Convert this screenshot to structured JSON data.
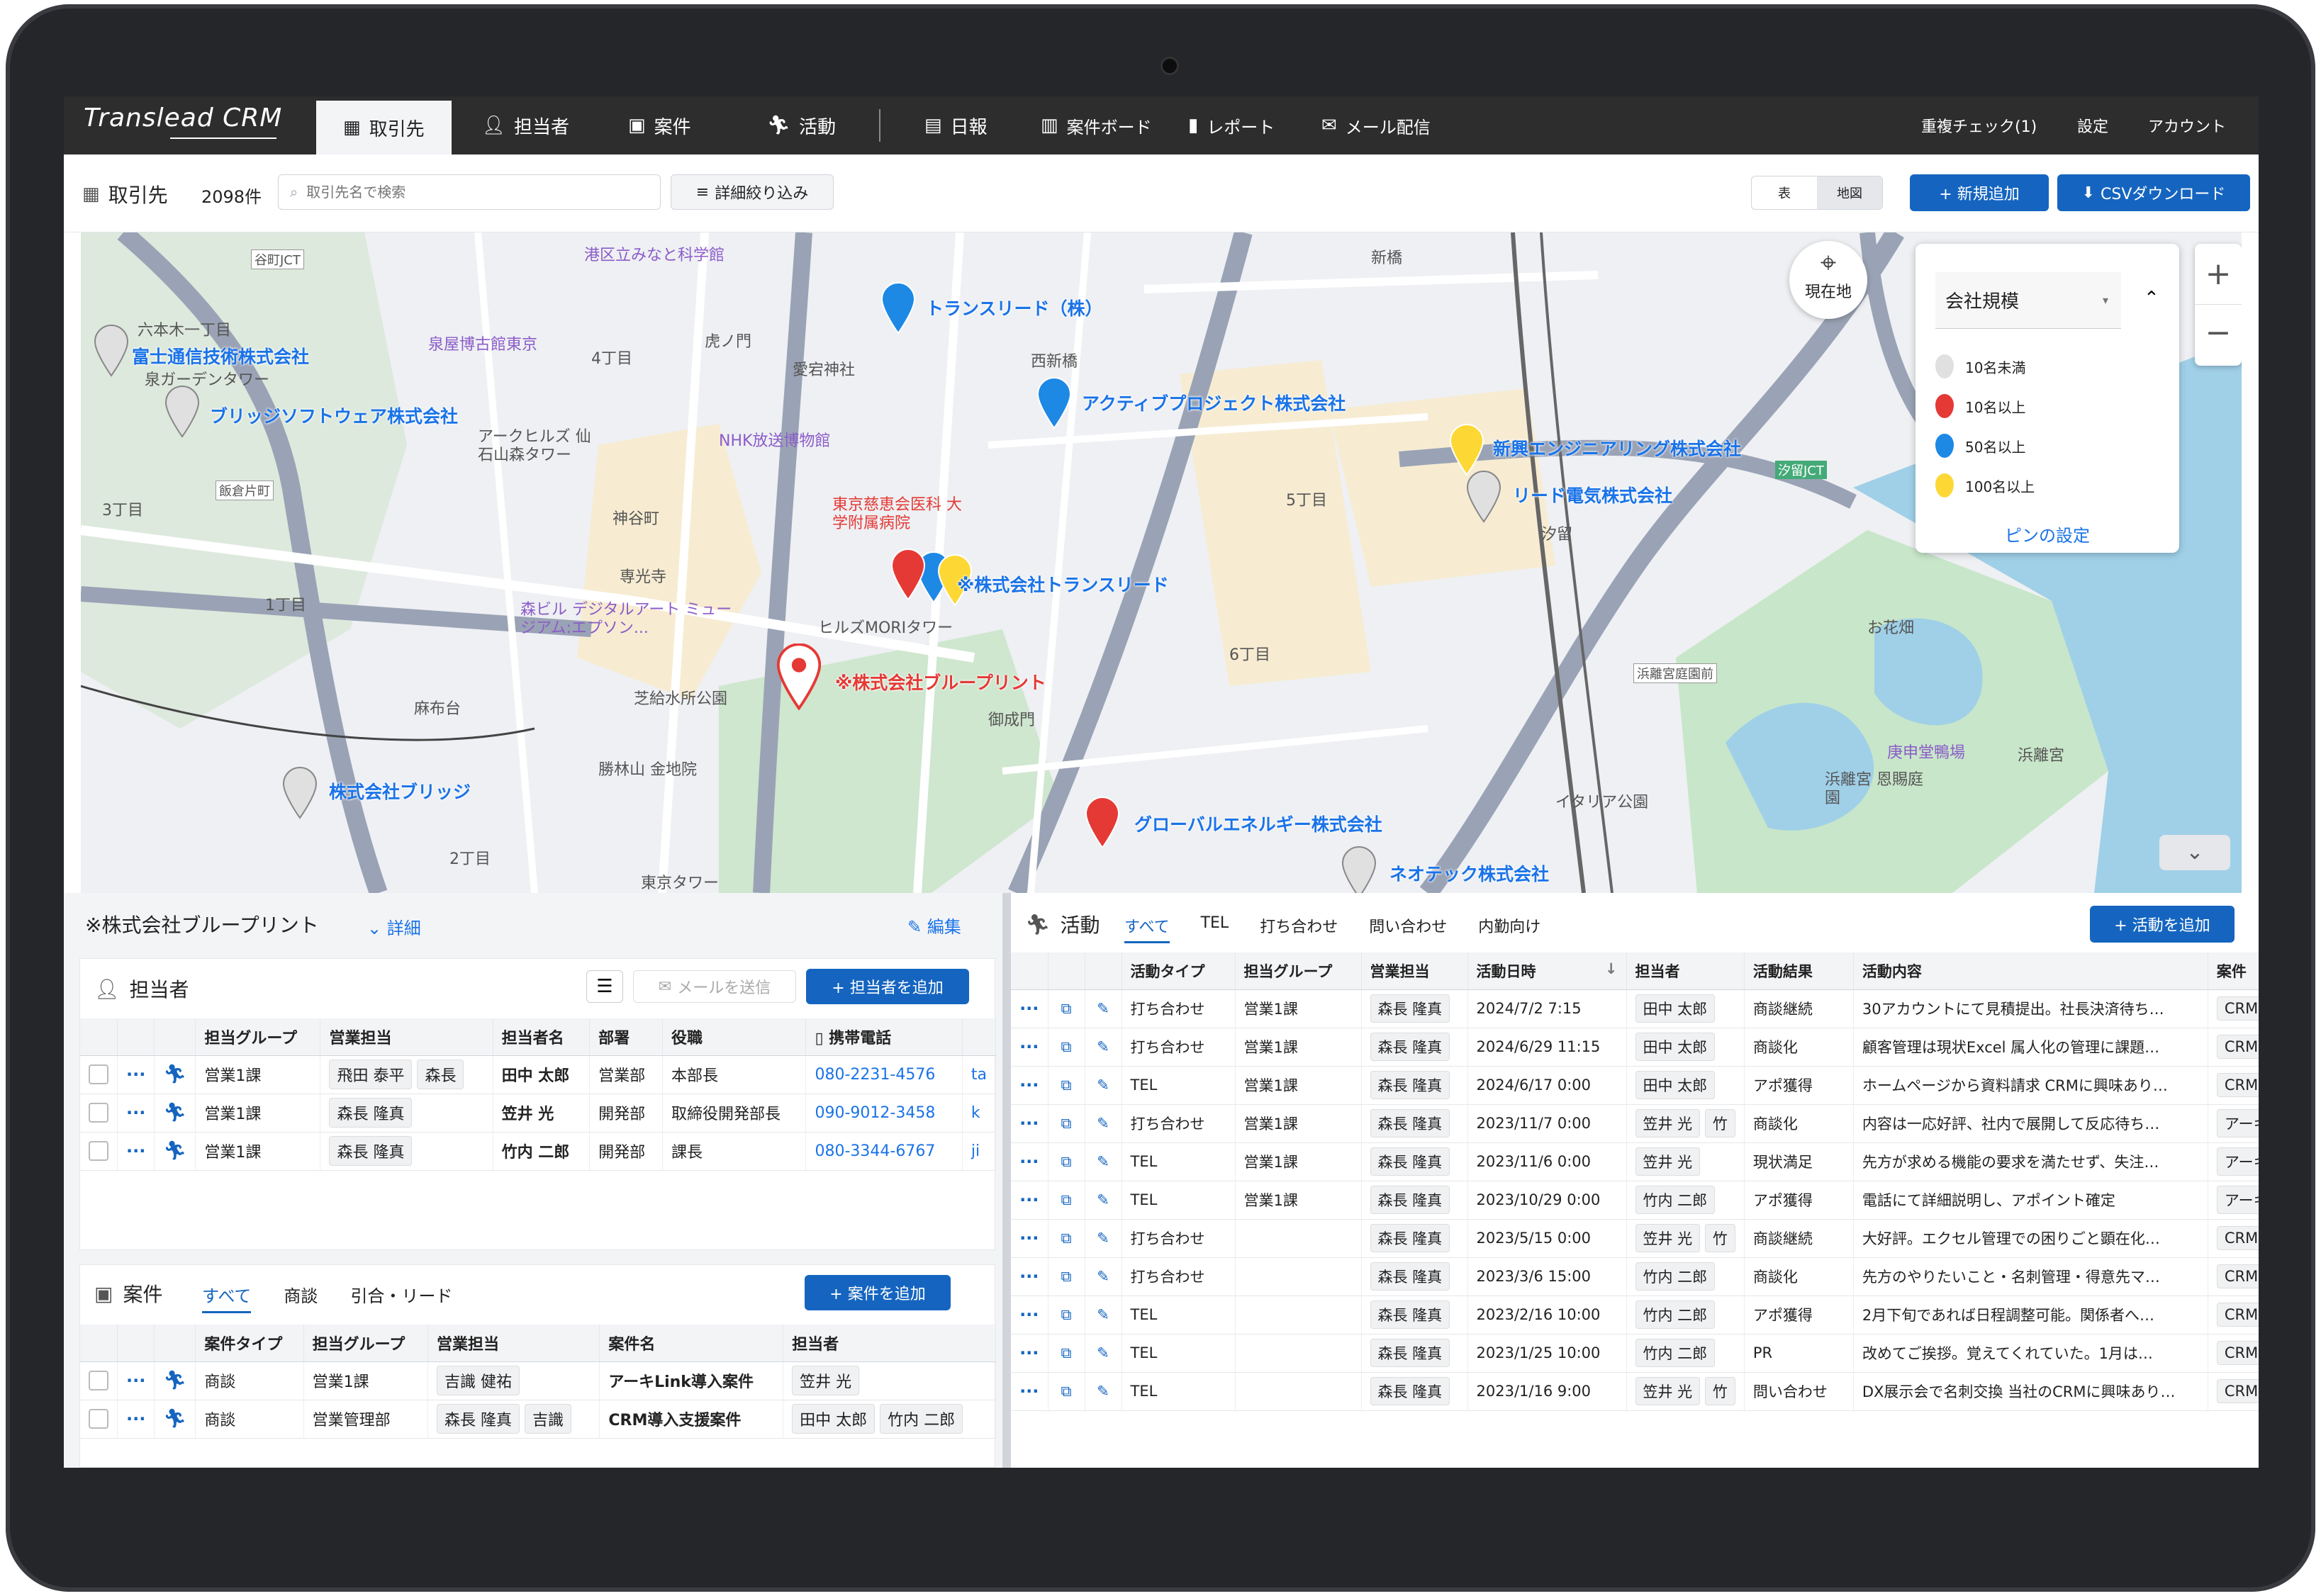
{
  "app": {
    "logo": "Translead CRM"
  },
  "nav": {
    "items": [
      {
        "label": "取引先",
        "icon": "building-icon",
        "active": true
      },
      {
        "label": "担当者",
        "icon": "person-icon"
      },
      {
        "label": "案件",
        "icon": "briefcase-icon"
      },
      {
        "label": "活動",
        "icon": "runner-icon"
      },
      {
        "label": "日報",
        "icon": "note-icon"
      },
      {
        "label": "案件ボード",
        "icon": "board-icon"
      },
      {
        "label": "レポート",
        "icon": "chart-icon"
      },
      {
        "label": "メール配信",
        "icon": "mail-icon"
      }
    ],
    "right": [
      "重複チェック(1)",
      "設定",
      "アカウント"
    ]
  },
  "toolbar": {
    "title": "取引先",
    "count": "2098件",
    "search_placeholder": "取引先名で検索",
    "filter_label": "詳細絞り込み",
    "view_table": "表",
    "view_map": "地図",
    "add_label": "+ 新規追加",
    "csv_label": "CSVダウンロード"
  },
  "map": {
    "current_location": "現在地",
    "legend": {
      "select": "会社規模",
      "items": [
        {
          "label": "10名未満",
          "color": "#e0e0e0"
        },
        {
          "label": "10名以上",
          "color": "#e53935"
        },
        {
          "label": "50名以上",
          "color": "#1e88e5"
        },
        {
          "label": "100名以上",
          "color": "#fdd835"
        }
      ],
      "settings_link": "ピンの設定"
    },
    "pins": [
      {
        "label": "トランスリード（株）",
        "color": "#1e88e5"
      },
      {
        "label": "富士通信技術株式会社",
        "color": "#e0e0e0"
      },
      {
        "label": "ブリッジソフトウェア株式会社",
        "color": "#e0e0e0"
      },
      {
        "label": "アクティブプロジェクト株式会社",
        "color": "#1e88e5"
      },
      {
        "label": "新興エンジニアリング株式会社",
        "color": "#fdd835"
      },
      {
        "label": "リード電気株式会社",
        "color": "#e0e0e0"
      },
      {
        "label": "※株式会社トランスリード",
        "color": "#e53935"
      },
      {
        "label": "※株式会社ブループリント",
        "color": "#ffffff"
      },
      {
        "label": "株式会社ブリッジ",
        "color": "#e0e0e0"
      },
      {
        "label": "グローバルエネルギー株式会社",
        "color": "#e53935"
      },
      {
        "label": "ネオテック株式会社",
        "color": "#e0e0e0"
      }
    ],
    "places": [
      "港区立みなと科学館",
      "泉屋博古館東京",
      "六本木一丁目",
      "泉ガーデンタワー",
      "アークヒルズ 仙石山森タワー",
      "虎ノ門",
      "愛宕神社",
      "NHK放送博物館",
      "西新橋",
      "新橋",
      "東京慈恵会医科 大学附属病院",
      "神谷町",
      "専光寺",
      "森ビル デジタルアート ミュージアム:エプソン...",
      "ヒルズMORIタワー",
      "芝給水所公園",
      "麻布台",
      "御成門",
      "勝林山 金地院",
      "東京タワー",
      "汐留",
      "お花畑",
      "浜離宮庭園前",
      "庚申堂鴨場",
      "浜離宮 恩賜庭園",
      "浜離宮",
      "イタリア公園",
      "飯倉片町",
      "3丁目",
      "1丁目",
      "2丁目",
      "4丁目",
      "5丁目",
      "6丁目",
      "谷町JCT",
      "汐留JCT"
    ]
  },
  "company": {
    "name": "※株式会社ブループリント",
    "detail": "詳細",
    "edit": "編集"
  },
  "contacts": {
    "title": "担当者",
    "mail_btn": "メールを送信",
    "add_btn": "+ 担当者を追加",
    "headers": [
      "担当グループ",
      "営業担当",
      "担当者名",
      "部署",
      "役職",
      "携帯電話"
    ],
    "rows": [
      {
        "group": "営業1課",
        "sales": "飛田 泰平",
        "sales2": "森長",
        "name": "田中 太郎",
        "dept": "営業部",
        "title": "本部長",
        "phone": "080-2231-4576",
        "extra": "ta"
      },
      {
        "group": "営業1課",
        "sales": "森長 隆真",
        "sales2": "",
        "name": "笠井 光",
        "dept": "開発部",
        "title": "取締役開発部長",
        "phone": "090-9012-3458",
        "extra": "k"
      },
      {
        "group": "営業1課",
        "sales": "森長 隆真",
        "sales2": "",
        "name": "竹内 二郎",
        "dept": "開発部",
        "title": "課長",
        "phone": "080-3344-6767",
        "extra": "ji"
      }
    ]
  },
  "deals": {
    "title": "案件",
    "tabs": [
      "すべて",
      "商談",
      "引合・リード"
    ],
    "add_btn": "+ 案件を追加",
    "headers": [
      "案件タイプ",
      "担当グループ",
      "営業担当",
      "案件名",
      "担当者"
    ],
    "rows": [
      {
        "type": "商談",
        "group": "営業1課",
        "sales": "吉識 健祐",
        "name": "アーキLink導入案件",
        "person": "笠井 光",
        "person2": ""
      },
      {
        "type": "商談",
        "group": "営業管理部",
        "sales": "森長 隆真",
        "sales2": "吉識",
        "name": "CRM導入支援案件",
        "person": "田中 太郎",
        "person2": "竹内 二郎"
      }
    ]
  },
  "activities": {
    "title": "活動",
    "tabs": [
      "すべて",
      "TEL",
      "打ち合わせ",
      "問い合わせ",
      "内勤向け"
    ],
    "add_btn": "+ 活動を追加",
    "headers": [
      "活動タイプ",
      "担当グループ",
      "営業担当",
      "活動日時",
      "担当者",
      "活動結果",
      "活動内容",
      "案件"
    ],
    "rows": [
      {
        "type": "打ち合わせ",
        "group": "営業1課",
        "sales": "森長 隆真",
        "date": "2024/7/2 7:15",
        "person": "田中 太郎",
        "result": "商談継続",
        "content": "30アカウントにて見積提出。社長決済待ち…",
        "deal": "CRM"
      },
      {
        "type": "打ち合わせ",
        "group": "営業1課",
        "sales": "森長 隆真",
        "date": "2024/6/29 11:15",
        "person": "田中 太郎",
        "result": "商談化",
        "content": "顧客管理は現状Excel 属人化の管理に課題…",
        "deal": "CRM"
      },
      {
        "type": "TEL",
        "group": "営業1課",
        "sales": "森長 隆真",
        "date": "2024/6/17 0:00",
        "person": "田中 太郎",
        "result": "アポ獲得",
        "content": "ホームページから資料請求 CRMに興味あり…",
        "deal": "CRM"
      },
      {
        "type": "打ち合わせ",
        "group": "営業1課",
        "sales": "森長 隆真",
        "date": "2023/11/7 0:00",
        "person": "笠井 光",
        "person2": "竹",
        "result": "商談化",
        "content": "内容は一応好評、社内で展開して反応待ち…",
        "deal": "アーキ"
      },
      {
        "type": "TEL",
        "group": "営業1課",
        "sales": "森長 隆真",
        "date": "2023/11/6 0:00",
        "person": "笠井 光",
        "result": "現状満足",
        "content": "先方が求める機能の要求を満たせず、失注…",
        "deal": "アーキ"
      },
      {
        "type": "TEL",
        "group": "営業1課",
        "sales": "森長 隆真",
        "date": "2023/10/29 0:00",
        "person": "竹内 二郎",
        "result": "アポ獲得",
        "content": "電話にて詳細説明し、アポイント確定",
        "deal": "アーキ"
      },
      {
        "type": "打ち合わせ",
        "group": "",
        "sales": "森長 隆真",
        "date": "2023/5/15 0:00",
        "person": "笠井 光",
        "person2": "竹",
        "result": "商談継続",
        "content": "大好評。エクセル管理での困りごと顕在化…",
        "deal": "CRM"
      },
      {
        "type": "打ち合わせ",
        "group": "",
        "sales": "森長 隆真",
        "date": "2023/3/6 15:00",
        "person": "竹内 二郎",
        "result": "商談化",
        "content": "先方のやりたいこと・名刺管理・得意先マ…",
        "deal": "CRM"
      },
      {
        "type": "TEL",
        "group": "",
        "sales": "森長 隆真",
        "date": "2023/2/16 10:00",
        "person": "竹内 二郎",
        "result": "アポ獲得",
        "content": "2月下旬であれば日程調整可能。関係者へ…",
        "deal": "CRM"
      },
      {
        "type": "TEL",
        "group": "",
        "sales": "森長 隆真",
        "date": "2023/1/25 10:00",
        "person": "竹内 二郎",
        "result": "PR",
        "content": "改めてご挨拶。覚えてくれていた。1月は…",
        "deal": "CRM"
      },
      {
        "type": "TEL",
        "group": "",
        "sales": "森長 隆真",
        "date": "2023/1/16 9:00",
        "person": "笠井 光",
        "person2": "竹",
        "result": "問い合わせ",
        "content": "DX展示会で名刺交換 当社のCRMに興味あり…",
        "deal": "CRM"
      }
    ]
  }
}
